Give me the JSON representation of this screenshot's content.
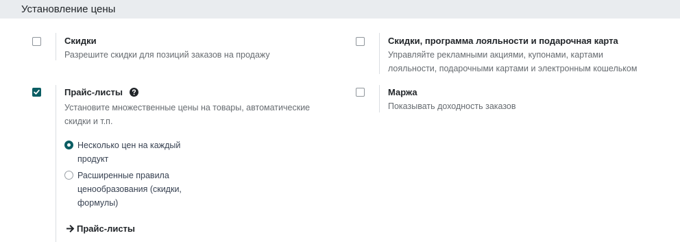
{
  "section": {
    "title": "Установление цены"
  },
  "settings": {
    "discounts": {
      "title": "Скидки",
      "description": "Разрешите скидки для позиций заказов на продажу",
      "checked": false
    },
    "loyalty": {
      "title": "Скидки, программа лояльности и подарочная карта",
      "description_line1": "Управляйте рекламными акциями, купонами, картами",
      "description_line2": "лояльности, подарочными картами и электронным кошельком",
      "checked": false
    },
    "pricelists": {
      "title": "Прайс-листы",
      "description_line1": "Установите множественные цены на товары, автоматические",
      "description_line2": "скидки и т.п.",
      "checked": true,
      "options": [
        {
          "line1": "Несколько цен на каждый",
          "line2": "продукт",
          "line3": "",
          "selected": true
        },
        {
          "line1": "Расширенные правила",
          "line2": "ценообразования (скидки,",
          "line3": "формулы)",
          "selected": false
        }
      ],
      "link_label": "Прайс-листы"
    },
    "margin": {
      "title": "Маржа",
      "description": "Показывать доходность заказов",
      "checked": false
    }
  },
  "colors": {
    "accent": "#0b5d63",
    "header_bg": "#e9ecef",
    "muted_text": "#666b70"
  },
  "icons": {
    "help": "question-circle-icon",
    "arrow": "arrow-right-icon"
  }
}
